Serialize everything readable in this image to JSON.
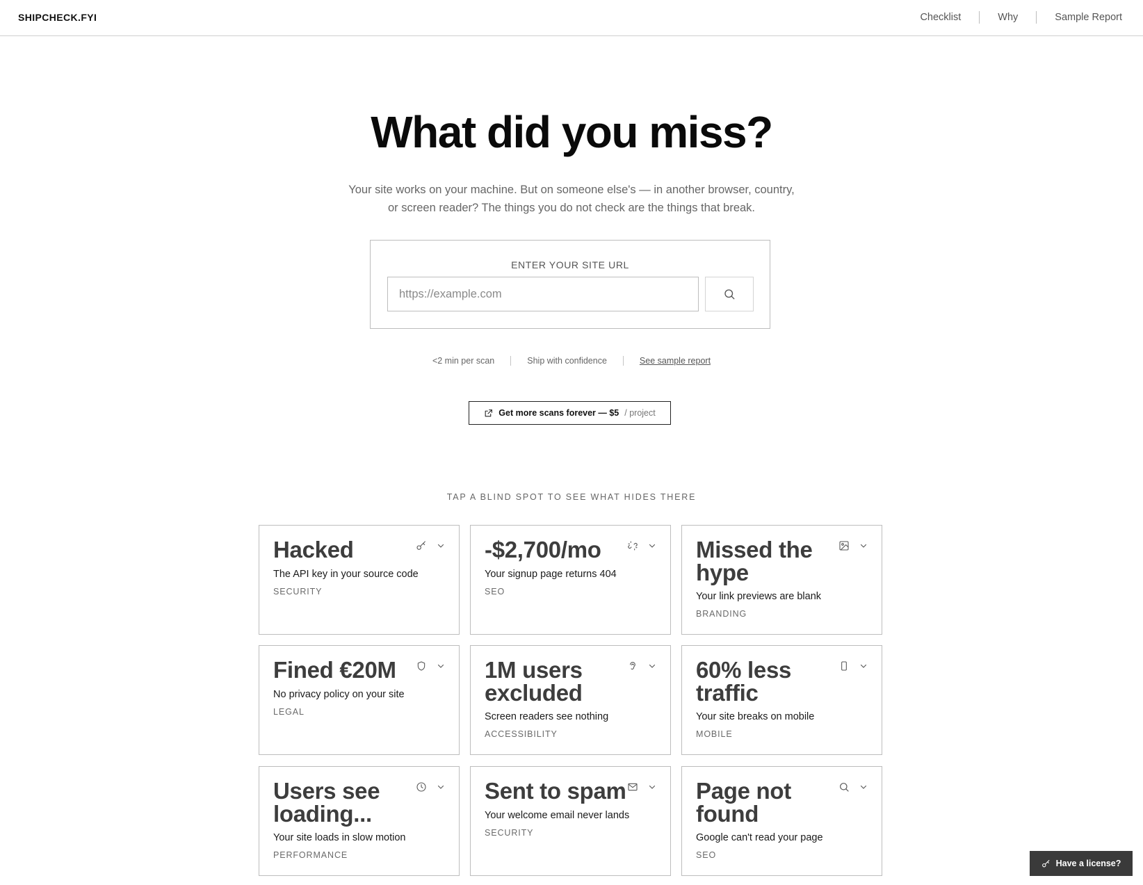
{
  "header": {
    "brand": "SHIPCHECK.FYI",
    "nav": [
      "Checklist",
      "Why",
      "Sample Report"
    ]
  },
  "hero": {
    "title": "What did you miss?",
    "subtitle_line1": "Your site works on your machine. But on someone else's — in another browser, country,",
    "subtitle_line2": "or screen reader? The things you do not check are the things that break."
  },
  "url_form": {
    "label": "ENTER YOUR SITE URL",
    "placeholder": "https://example.com",
    "value": "",
    "button_icon": "search-icon"
  },
  "meta": {
    "item1": "<2 min per scan",
    "item2": "Ship with confidence",
    "link": "See sample report"
  },
  "cta": {
    "icon": "external-link-icon",
    "main": "Get more scans forever — $5",
    "sub": "/ project"
  },
  "section_label": "TAP A BLIND SPOT TO SEE WHAT HIDES THERE",
  "cards": [
    {
      "title": "Hacked",
      "desc": "The API key in your source code",
      "category": "SECURITY",
      "icon": "key-icon"
    },
    {
      "title": "-$2,700/mo",
      "desc": "Your signup page returns 404",
      "category": "SEO",
      "icon": "broken-link-icon"
    },
    {
      "title": "Missed the hype",
      "desc": "Your link previews are blank",
      "category": "BRANDING",
      "icon": "image-icon"
    },
    {
      "title": "Fined €20M",
      "desc": "No privacy policy on your site",
      "category": "LEGAL",
      "icon": "shield-icon"
    },
    {
      "title": "1M users excluded",
      "desc": "Screen readers see nothing",
      "category": "ACCESSIBILITY",
      "icon": "ear-icon"
    },
    {
      "title": "60% less traffic",
      "desc": "Your site breaks on mobile",
      "category": "MOBILE",
      "icon": "phone-icon"
    },
    {
      "title": "Users see loading...",
      "desc": "Your site loads in slow motion",
      "category": "PERFORMANCE",
      "icon": "clock-icon"
    },
    {
      "title": "Sent to spam",
      "desc": "Your welcome email never lands",
      "category": "SECURITY",
      "icon": "mail-icon"
    },
    {
      "title": "Page not found",
      "desc": "Google can't read your page",
      "category": "SEO",
      "icon": "search-icon"
    }
  ],
  "license_button": {
    "icon": "key-icon",
    "label": "Have a license?"
  },
  "colors": {
    "text": "#111111",
    "muted": "#666666",
    "border": "#bdbdbd",
    "card_title": "#3d3d3d",
    "license_bg": "#3a3a3a"
  }
}
